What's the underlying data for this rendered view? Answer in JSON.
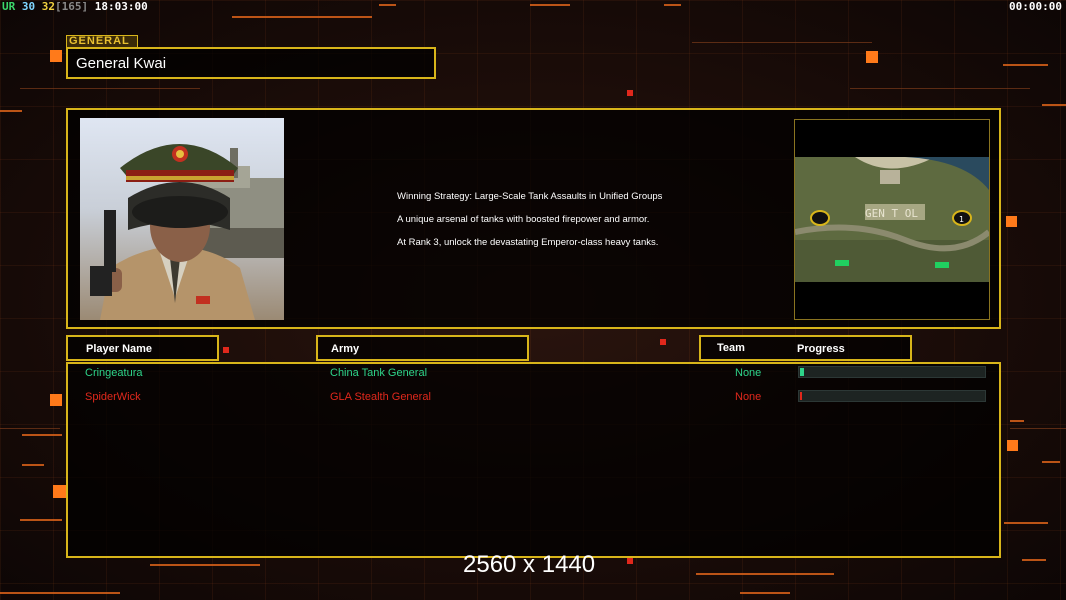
{
  "hud": {
    "ur_label": "UR",
    "stat1": "30",
    "stat2": "32",
    "stat3": "[165]",
    "clock": "18:03:00",
    "timer": "00:00:00"
  },
  "general": {
    "tag": "GENERAL",
    "name": "General Kwai",
    "description": [
      "Winning Strategy: Large-Scale Tank Assaults in Unified Groups",
      "A unique arsenal of tanks with boosted firepower and armor.",
      "At Rank 3, unlock the devastating Emperor-class heavy tanks."
    ]
  },
  "table": {
    "headers": {
      "player_name": "Player Name",
      "army": "Army",
      "team": "Team",
      "progress": "Progress"
    },
    "rows": [
      {
        "name": "Cringeatura",
        "army": "China Tank General",
        "team": "None",
        "progress": 0.02,
        "color": "#2ed48a"
      },
      {
        "name": "SpiderWick",
        "army": "GLA Stealth General",
        "team": "None",
        "progress": 0.01,
        "color": "#e0281c"
      }
    ]
  },
  "resolution_text": "2560 x 1440",
  "colors": {
    "accent": "#d8b51a",
    "orange": "#ff7a1a",
    "player1": "#2ed48a",
    "player2": "#e0281c"
  }
}
